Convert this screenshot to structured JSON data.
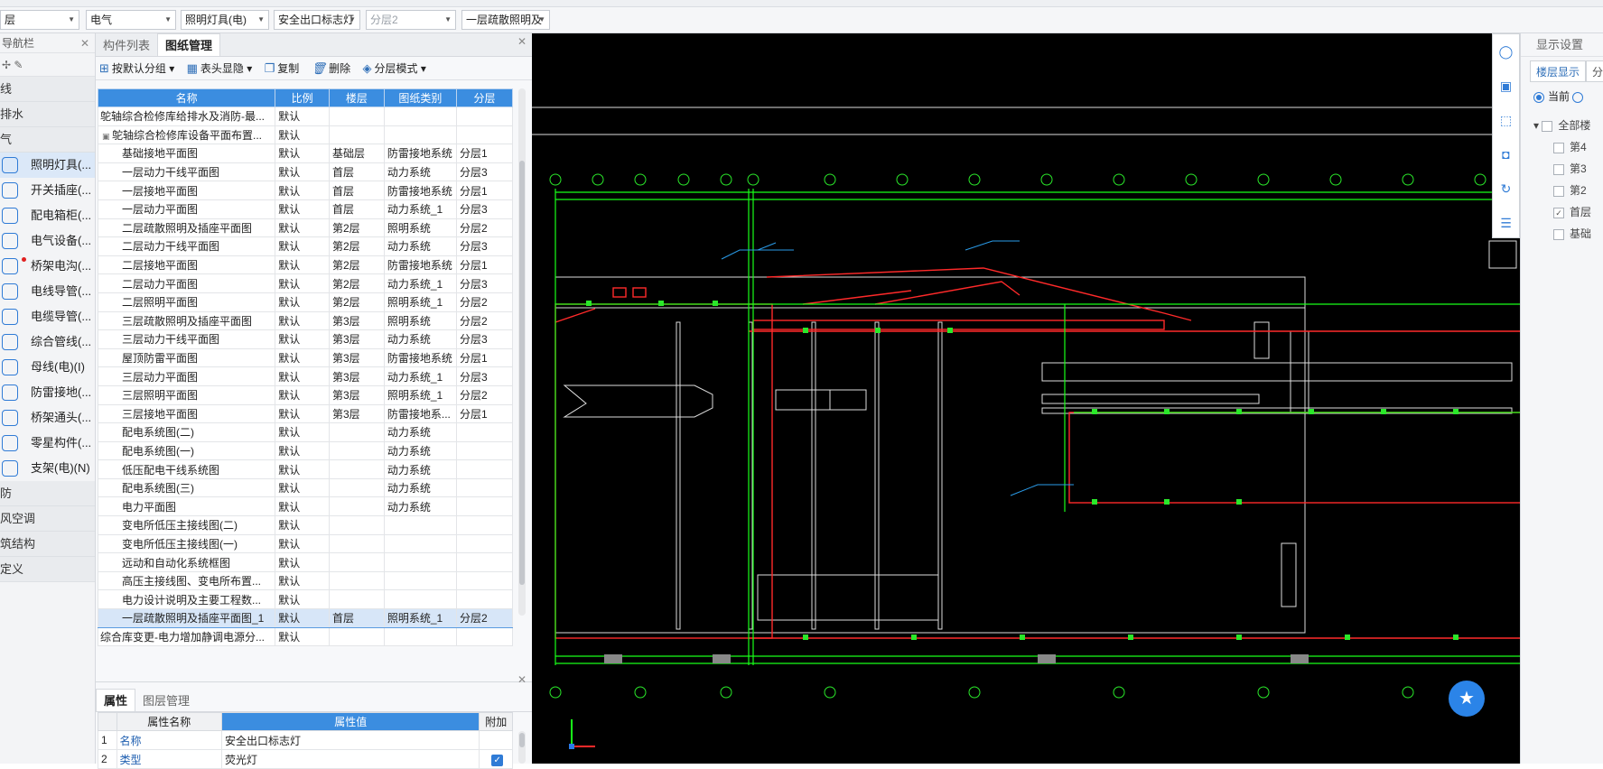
{
  "toolbar": {
    "floor_select": "层",
    "discipline_select": "电气",
    "type_select": "照明灯具(电)",
    "component_select": "安全出口标志灯",
    "layer_select": "分层2",
    "drawing_select": "一层疏散照明及"
  },
  "nav": {
    "title": "导航栏",
    "groups": {
      "g1": "线",
      "g2": "排水",
      "g3": "气",
      "g4": "防",
      "g5": "风空调",
      "g6": "筑结构",
      "g7": "定义"
    },
    "items": [
      {
        "label": "照明灯具(...",
        "icon": "lamp-icon"
      },
      {
        "label": "开关插座(...",
        "icon": "switch-icon"
      },
      {
        "label": "配电箱柜(...",
        "icon": "cabinet-icon"
      },
      {
        "label": "电气设备(...",
        "icon": "device-icon"
      },
      {
        "label": "桥架电沟(...",
        "icon": "tray-icon"
      },
      {
        "label": "电线导管(...",
        "icon": "wire-icon"
      },
      {
        "label": "电缆导管(...",
        "icon": "cable-icon"
      },
      {
        "label": "综合管线(...",
        "icon": "pipeline-icon"
      },
      {
        "label": "母线(电)(I)",
        "icon": "busbar-icon"
      },
      {
        "label": "防雷接地(...",
        "icon": "lightning-icon"
      },
      {
        "label": "桥架通头(...",
        "icon": "fitting-icon"
      },
      {
        "label": "零星构件(...",
        "icon": "misc-icon"
      },
      {
        "label": "支架(电)(N)",
        "icon": "bracket-icon"
      }
    ]
  },
  "drawings": {
    "tabs": [
      "构件列表",
      "图纸管理"
    ],
    "actions": {
      "group": "按默认分组",
      "columns": "表头显隐",
      "copy": "复制",
      "delete": "删除",
      "layer_mode": "分层模式"
    },
    "columns": [
      "名称",
      "比例",
      "楼层",
      "图纸类别",
      "分层"
    ],
    "rows": [
      [
        "鸵轴综合检修库给排水及消防-最...",
        "默认",
        "",
        "",
        ""
      ],
      [
        "鸵轴综合检修库设备平面布置...",
        "默认",
        "",
        "",
        ""
      ],
      [
        "基础接地平面图",
        "默认",
        "基础层",
        "防雷接地系统",
        "分层1"
      ],
      [
        "一层动力干线平面图",
        "默认",
        "首层",
        "动力系统",
        "分层3"
      ],
      [
        "一层接地平面图",
        "默认",
        "首层",
        "防雷接地系统",
        "分层1"
      ],
      [
        "一层动力平面图",
        "默认",
        "首层",
        "动力系统_1",
        "分层3"
      ],
      [
        "二层疏散照明及插座平面图",
        "默认",
        "第2层",
        "照明系统",
        "分层2"
      ],
      [
        "二层动力干线平面图",
        "默认",
        "第2层",
        "动力系统",
        "分层3"
      ],
      [
        "二层接地平面图",
        "默认",
        "第2层",
        "防雷接地系统",
        "分层1"
      ],
      [
        "二层动力平面图",
        "默认",
        "第2层",
        "动力系统_1",
        "分层3"
      ],
      [
        "二层照明平面图",
        "默认",
        "第2层",
        "照明系统_1",
        "分层2"
      ],
      [
        "三层疏散照明及插座平面图",
        "默认",
        "第3层",
        "照明系统",
        "分层2"
      ],
      [
        "三层动力干线平面图",
        "默认",
        "第3层",
        "动力系统",
        "分层3"
      ],
      [
        "屋顶防雷平面图",
        "默认",
        "第3层",
        "防雷接地系统",
        "分层1"
      ],
      [
        "三层动力平面图",
        "默认",
        "第3层",
        "动力系统_1",
        "分层3"
      ],
      [
        "三层照明平面图",
        "默认",
        "第3层",
        "照明系统_1",
        "分层2"
      ],
      [
        "三层接地平面图",
        "默认",
        "第3层",
        "防雷接地系...",
        "分层1"
      ],
      [
        "配电系统图(二)",
        "默认",
        "",
        "动力系统",
        ""
      ],
      [
        "配电系统图(一)",
        "默认",
        "",
        "动力系统",
        ""
      ],
      [
        "低压配电干线系统图",
        "默认",
        "",
        "动力系统",
        ""
      ],
      [
        "配电系统图(三)",
        "默认",
        "",
        "动力系统",
        ""
      ],
      [
        "电力平面图",
        "默认",
        "",
        "动力系统",
        ""
      ],
      [
        "变电所低压主接线图(二)",
        "默认",
        "",
        "",
        ""
      ],
      [
        "变电所低压主接线图(一)",
        "默认",
        "",
        "",
        ""
      ],
      [
        "远动和自动化系统框图",
        "默认",
        "",
        "",
        ""
      ],
      [
        "高压主接线图、变电所布置...",
        "默认",
        "",
        "",
        ""
      ],
      [
        "电力设计说明及主要工程数...",
        "默认",
        "",
        "",
        ""
      ],
      [
        "一层疏散照明及插座平面图_1",
        "默认",
        "首层",
        "照明系统_1",
        "分层2"
      ],
      [
        "综合库变更-电力增加静调电源分...",
        "默认",
        "",
        "",
        ""
      ]
    ]
  },
  "properties": {
    "tabs": [
      "属性",
      "图层管理"
    ],
    "columns": [
      "属性名称",
      "属性值",
      "附加"
    ],
    "rows": [
      {
        "num": "1",
        "name": "名称",
        "value": "安全出口标志灯"
      },
      {
        "num": "2",
        "name": "类型",
        "value": "荧光灯"
      }
    ]
  },
  "display": {
    "title": "显示设置",
    "tabs": [
      "楼层显示",
      "分"
    ],
    "radio_label": "当前",
    "tree": [
      "全部楼",
      "第4",
      "第3",
      "第2",
      "首层",
      "基础"
    ]
  }
}
